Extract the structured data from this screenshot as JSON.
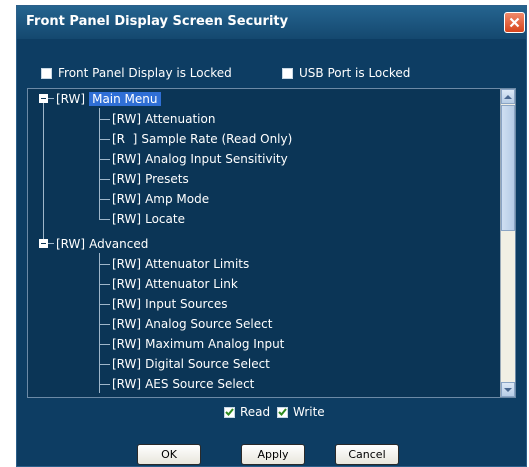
{
  "window": {
    "title": "Front Panel Display Screen Security"
  },
  "options": {
    "front_panel_locked": {
      "label": "Front Panel Display is Locked",
      "checked": false
    },
    "usb_locked": {
      "label": "USB Port is Locked",
      "checked": false
    }
  },
  "tree": {
    "groups": [
      {
        "prefix": "[RW]",
        "label": "Main Menu",
        "selected": true,
        "expanded": true,
        "items": [
          {
            "prefix": "[RW]",
            "label": "Attenuation"
          },
          {
            "prefix": "[R  ]",
            "label": "Sample Rate (Read Only)"
          },
          {
            "prefix": "[RW]",
            "label": "Analog Input Sensitivity"
          },
          {
            "prefix": "[RW]",
            "label": "Presets"
          },
          {
            "prefix": "[RW]",
            "label": "Amp Mode"
          },
          {
            "prefix": "[RW]",
            "label": "Locate"
          }
        ]
      },
      {
        "prefix": "[RW]",
        "label": "Advanced",
        "selected": false,
        "expanded": true,
        "items": [
          {
            "prefix": "[RW]",
            "label": "Attenuator Limits"
          },
          {
            "prefix": "[RW]",
            "label": "Attenuator Link"
          },
          {
            "prefix": "[RW]",
            "label": "Input Sources"
          },
          {
            "prefix": "[RW]",
            "label": "Analog Source Select"
          },
          {
            "prefix": "[RW]",
            "label": "Maximum Analog Input"
          },
          {
            "prefix": "[RW]",
            "label": "Digital Source Select"
          },
          {
            "prefix": "[RW]",
            "label": "AES Source Select"
          }
        ]
      }
    ]
  },
  "permissions": {
    "read": {
      "label": "Read",
      "checked": true
    },
    "write": {
      "label": "Write",
      "checked": true
    }
  },
  "buttons": {
    "ok": "OK",
    "apply": "Apply",
    "cancel": "Cancel"
  },
  "icons": {
    "close": "close-icon",
    "scroll_up": "arrow-up-icon",
    "scroll_down": "arrow-down-icon",
    "check": "checkmark-icon"
  },
  "colors": {
    "window_bg": "#0d3d63",
    "selection": "#2f6fd6",
    "check": "#2f8a20",
    "close_button": "#d6451d"
  }
}
